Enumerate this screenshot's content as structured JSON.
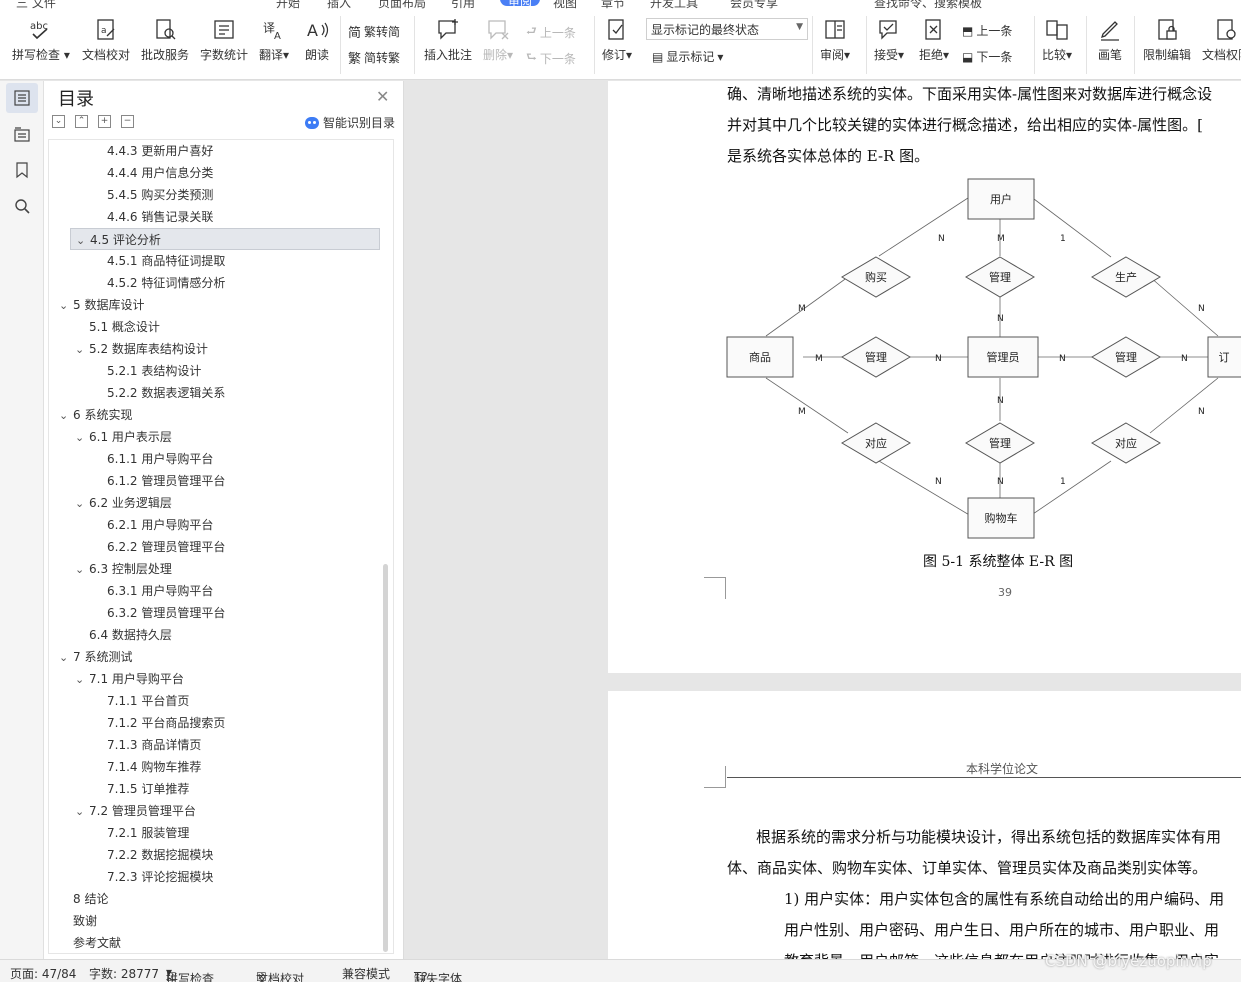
{
  "menubar": {
    "tabs": [
      "三 文件",
      "开始",
      "插入",
      "页面布局",
      "引用",
      "审阅",
      "视图",
      "章节",
      "开发工具",
      "会员专享",
      "查找命令、搜索模板"
    ],
    "active_tab": "审阅"
  },
  "ribbon": {
    "spell_check": "拼写检查",
    "doc_proof": "文档校对",
    "annotate_service": "批改服务",
    "word_count": "字数统计",
    "translate": "翻译",
    "read_aloud": "朗读",
    "to_traditional": "繁转简",
    "to_simplified": "简转繁",
    "insert_comment": "插入批注",
    "delete": "删除",
    "prev_comment": "上一条",
    "next_comment": "下一条",
    "revise": "修订",
    "markup_state": "显示标记的最终状态",
    "show_markup": "显示标记",
    "review": "审阅",
    "accept": "接受",
    "reject": "拒绝",
    "prev_change": "上一条",
    "next_change": "下一条",
    "compare": "比较",
    "pen": "画笔",
    "restrict_edit": "限制编辑",
    "doc_rights": "文档权限"
  },
  "toc": {
    "title": "目录",
    "smart_label": "智能识别目录",
    "items": [
      {
        "text": "4.4.3 更新用户喜好",
        "level": 3
      },
      {
        "text": "4.4.4 用户信息分类",
        "level": 3
      },
      {
        "text": "5.4.5 购买分类预测",
        "level": 3
      },
      {
        "text": "4.4.6 销售记录关联",
        "level": 3
      },
      {
        "text": "4.5 评论分析",
        "level": 2,
        "expanded": true,
        "selected": true
      },
      {
        "text": "4.5.1  商品特征词提取",
        "level": 3
      },
      {
        "text": "4.5.2  特征词情感分析",
        "level": 3
      },
      {
        "text": "5  数据库设计",
        "level": 1,
        "expanded": true
      },
      {
        "text": "5.1  概念设计",
        "level": 2
      },
      {
        "text": "5.2  数据库表结构设计",
        "level": 2,
        "expanded": true
      },
      {
        "text": "5.2.1 表结构设计",
        "level": 3
      },
      {
        "text": "5.2.2 数据表逻辑关系",
        "level": 3
      },
      {
        "text": "6  系统实现",
        "level": 1,
        "expanded": true
      },
      {
        "text": "6.1  用户表示层",
        "level": 2,
        "expanded": true
      },
      {
        "text": "6.1.1 用户导购平台",
        "level": 3
      },
      {
        "text": "6.1.2 管理员管理平台",
        "level": 3
      },
      {
        "text": "6.2  业务逻辑层",
        "level": 2,
        "expanded": true
      },
      {
        "text": "6.2.1 用户导购平台",
        "level": 3
      },
      {
        "text": "6.2.2 管理员管理平台",
        "level": 3
      },
      {
        "text": "6.3 控制层处理",
        "level": 2,
        "expanded": true
      },
      {
        "text": "6.3.1 用户导购平台",
        "level": 3
      },
      {
        "text": "6.3.2 管理员管理平台",
        "level": 3
      },
      {
        "text": "6.4  数据持久层",
        "level": 2
      },
      {
        "text": "7  系统测试",
        "level": 1,
        "expanded": true
      },
      {
        "text": "7.1  用户导购平台",
        "level": 2,
        "expanded": true
      },
      {
        "text": "7.1.1 平台首页",
        "level": 3
      },
      {
        "text": "7.1.2 平台商品搜索页",
        "level": 3
      },
      {
        "text": "7.1.3 商品详情页",
        "level": 3
      },
      {
        "text": "7.1.4  购物车推荐",
        "level": 3
      },
      {
        "text": "7.1.5  订单推荐",
        "level": 3
      },
      {
        "text": "7.2 管理员管理平台",
        "level": 2,
        "expanded": true
      },
      {
        "text": "7.2.1 服装管理",
        "level": 3
      },
      {
        "text": "7.2.2  数据挖掘模块",
        "level": 3
      },
      {
        "text": "7.2.3  评论挖掘模块",
        "level": 3
      },
      {
        "text": "8  结论",
        "level": 1
      },
      {
        "text": "致谢",
        "level": 1
      },
      {
        "text": "参考文献",
        "level": 1
      }
    ]
  },
  "page1": {
    "lines": [
      "确、清晰地描述系统的实体。下面采用实体-属性图来对数据库进行概念设",
      "并对其中几个比较关键的实体进行概念描述，给出相应的实体-属性图。[",
      "是系统各实体总体的 E-R 图。"
    ],
    "caption": "图 5-1  系统整体 E-R 图",
    "page_number": "39"
  },
  "er_diagram": {
    "entities": {
      "user": "用户",
      "product": "商品",
      "admin": "管理员",
      "order": "订",
      "cart": "购物车"
    },
    "relations": {
      "buy": "购买",
      "manage_top": "管理",
      "produce": "生产",
      "manage_left": "管理",
      "manage_right": "管理",
      "correspond_left": "对应",
      "manage_bottom": "管理",
      "correspond_right": "对应"
    },
    "cardinalities": {
      "n": "N",
      "m": "M",
      "one": "1"
    }
  },
  "page2": {
    "header": "本科学位论文",
    "lines": [
      "根据系统的需求分析与功能模块设计，得出系统包括的数据库实体有用",
      "体、商品实体、购物车实体、订单实体、管理员实体及商品类别实体等。",
      "1) 用户实体：用户实体包含的属性有系统自动给出的用户编码、用",
      "用户性别、用户密码、用户生日、用户所在的城市、用户职业、用",
      "教育背景、用户邮箱，这些信息都在用户注册时进行收集，用户实"
    ]
  },
  "statusbar": {
    "page": "页面: 47/84",
    "words": "字数: 28777",
    "spell": "拼写检查",
    "proof": "文档校对",
    "compat": "兼容模式",
    "missing_font": "缺失字体"
  },
  "watermark": "CSDN @biyezuopinvip"
}
